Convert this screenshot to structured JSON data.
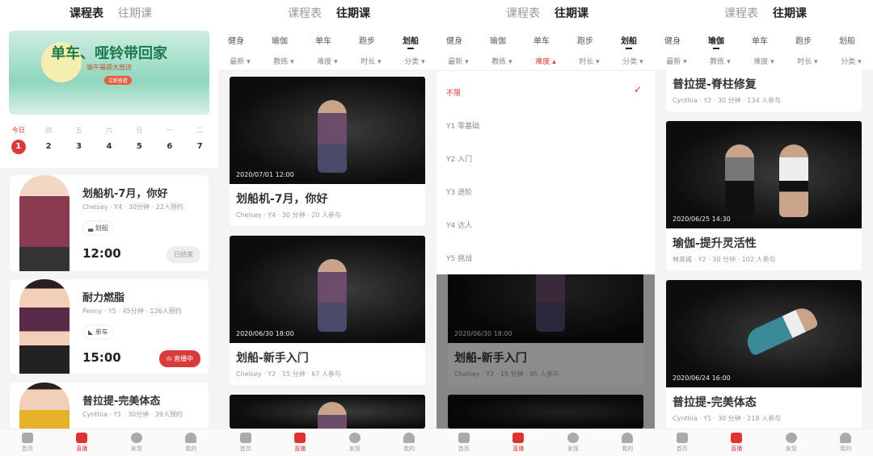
{
  "top_tabs": [
    "课程表",
    "往期课"
  ],
  "categories": [
    "健身",
    "瑜伽",
    "单车",
    "跑步",
    "划船"
  ],
  "filters": [
    "最新",
    "教练",
    "难度",
    "时长",
    "分类"
  ],
  "nav": [
    "首页",
    "直播",
    "发现",
    "我的"
  ],
  "colors": {
    "accent": "#d93a3a"
  },
  "schedule": {
    "banner": {
      "title": "单车、哑铃带回家",
      "subtitle": "端午福袋大放送",
      "cta": "立即查看"
    },
    "week": [
      {
        "day": "今日",
        "date": "1"
      },
      {
        "day": "四",
        "date": "2"
      },
      {
        "day": "五",
        "date": "3"
      },
      {
        "day": "六",
        "date": "4"
      },
      {
        "day": "日",
        "date": "5"
      },
      {
        "day": "一",
        "date": "6"
      },
      {
        "day": "二",
        "date": "7"
      }
    ],
    "classes": [
      {
        "title": "划船机-7月，你好",
        "meta": "Chelsey · Y4 · 30分钟 · 22人预约",
        "tag": "划船",
        "time": "12:00",
        "status": "已结束"
      },
      {
        "title": "耐力燃脂",
        "meta": "Penny · Y5 · 45分钟 · 126人预约",
        "tag": "单车",
        "time": "15:00",
        "status": "直播中"
      },
      {
        "title": "普拉提-完美体态",
        "meta": "Cynthia · Y1 · 30分钟 · 39人预约"
      }
    ]
  },
  "past_rowing": [
    {
      "date": "2020/07/01 12:00",
      "title": "划船机-7月，你好",
      "meta": "Chelsey  ·  Y4  ·  30 分钟  ·  20 人参与"
    },
    {
      "date": "2020/06/30 18:00",
      "title": "划船-新手入门",
      "meta": "Chelsey  ·  Y2  ·  15 分钟  ·  67 人参与"
    }
  ],
  "difficulty_dropdown": {
    "options": [
      "不限",
      "Y1 零基础",
      "Y2 入门",
      "Y3 进阶",
      "Y4 达人",
      "Y5 挑战"
    ],
    "selected": "不限",
    "behind": {
      "date": "2020/06/30 18:00",
      "title": "划船-新手入门",
      "meta": "Chelsey  ·  Y2  ·  15 分钟  ·  95 人参与"
    }
  },
  "past_yoga": [
    {
      "title": "普拉提-脊柱修复",
      "meta": "Cynthia  ·  Y2  ·  30 分钟  ·  134 人参与"
    },
    {
      "date": "2020/06/25 14:30",
      "title": "瑜伽-提升灵活性",
      "meta": "林英城  ·  Y2  ·  30 分钟  ·  102 人参与"
    },
    {
      "date": "2020/06/24 16:00",
      "title": "普拉提-完美体态",
      "meta": "Cynthia  ·  Y1  ·  30 分钟  ·  218 人参与"
    }
  ]
}
